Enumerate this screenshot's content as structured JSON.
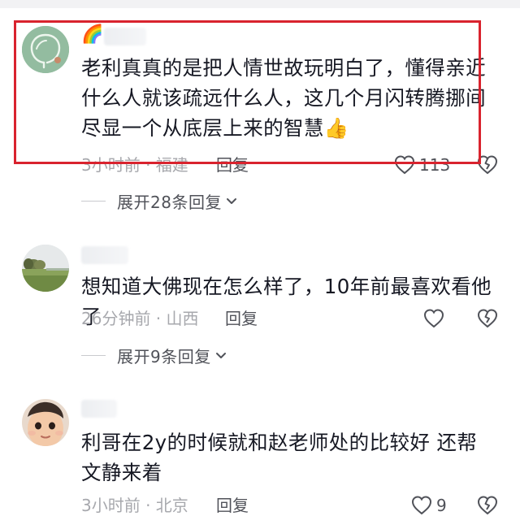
{
  "comments": [
    {
      "text": "老利真真的是把人情世故玩明白了，懂得亲近什么人就该疏远什么人，这几个月闪转腾挪间尽显一个从底层上来的智慧👍",
      "meta": "3小时前 · 福建",
      "reply_label": "回复",
      "like_count": "113",
      "expand_label": "展开28条回复",
      "name_prefix": "🌈"
    },
    {
      "text": "想知道大佛现在怎么样了，10年前最喜欢看他了",
      "meta": "26分钟前 · 山西",
      "reply_label": "回复",
      "like_count": "",
      "expand_label": "展开9条回复"
    },
    {
      "text": "利哥在2y的时候就和赵老师处的比较好 还帮文静来着",
      "meta": "3小时前 · 北京",
      "reply_label": "回复",
      "like_count": "9"
    }
  ],
  "colors": {
    "highlight": "#d9232e",
    "muted_text": "#a7a8ad",
    "action_text": "#505259"
  }
}
